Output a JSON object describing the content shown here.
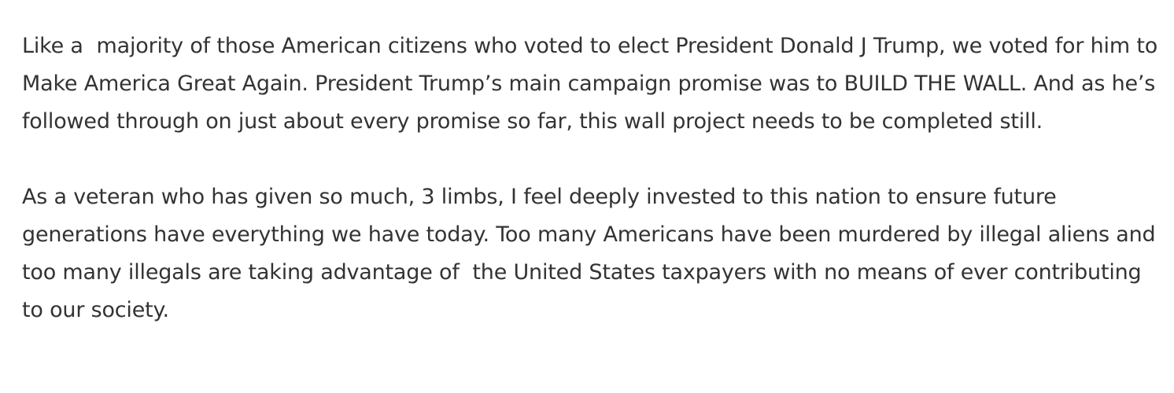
{
  "article": {
    "paragraphs": [
      "Like a  majority of those American citizens who voted to elect President Donald J Trump, we voted for him to Make America Great Again. President Trump’s main campaign promise was to BUILD THE WALL. And as he’s followed through on just about every promise so far, this wall project needs to be completed still.",
      "As a veteran who has given so much, 3 limbs, I feel deeply invested to this nation to ensure future generations have everything we have today. Too many Americans have been murdered by illegal aliens and too many illegals are taking advantage of  the United States taxpayers with no means of ever contributing to our society."
    ]
  }
}
